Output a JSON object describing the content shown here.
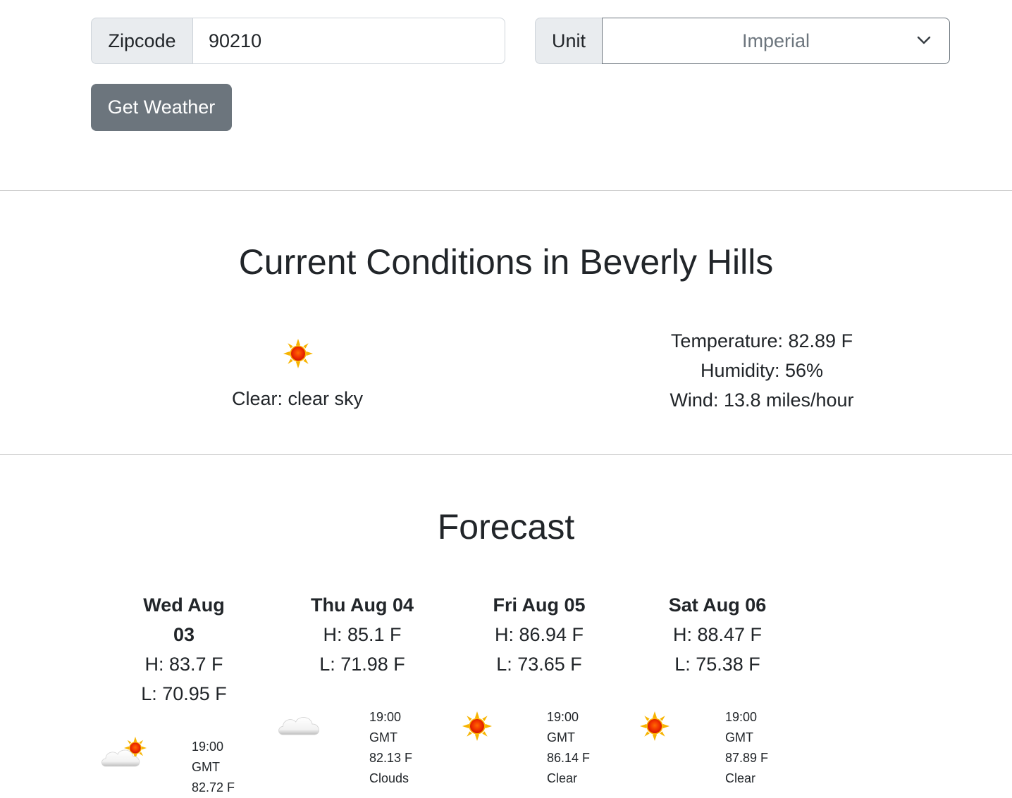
{
  "form": {
    "zip_label": "Zipcode",
    "zip_value": "90210",
    "unit_label": "Unit",
    "unit_value": "Imperial",
    "submit_label": "Get Weather"
  },
  "current": {
    "title": "Current Conditions in Beverly Hills",
    "icon": "clear-sky-sun-icon",
    "description": "Clear: clear sky",
    "temperature": "Temperature: 82.89 F",
    "humidity": "Humidity: 56%",
    "wind": "Wind: 13.8 miles/hour"
  },
  "forecast": {
    "title": "Forecast",
    "days": [
      {
        "name_line1": "Wed Aug",
        "name_line2": "03",
        "high": "H: 83.7 F",
        "low": "L: 70.95 F",
        "slot": {
          "icon": "partly-cloudy-icon",
          "time": "19:00",
          "zone": "GMT",
          "temp": "82.72 F"
        }
      },
      {
        "name_line1": "Thu Aug 04",
        "high": "H: 85.1 F",
        "low": "L: 71.98 F",
        "slot": {
          "icon": "clouds-icon",
          "time": "19:00",
          "zone": "GMT",
          "temp": "82.13 F",
          "cond": "Clouds"
        }
      },
      {
        "name_line1": "Fri Aug 05",
        "high": "H: 86.94 F",
        "low": "L: 73.65 F",
        "slot": {
          "icon": "clear-sun-icon",
          "time": "19:00",
          "zone": "GMT",
          "temp": "86.14 F",
          "cond": "Clear"
        }
      },
      {
        "name_line1": "Sat Aug 06",
        "high": "H: 88.47 F",
        "low": "L: 75.38 F",
        "slot": {
          "icon": "clear-sun-icon",
          "time": "19:00",
          "zone": "GMT",
          "temp": "87.89 F",
          "cond": "Clear"
        }
      }
    ]
  },
  "colors": {
    "button_bg": "#6c757d",
    "addon_bg": "#e9ecef",
    "text": "#212529",
    "sun": "#f5a300"
  }
}
